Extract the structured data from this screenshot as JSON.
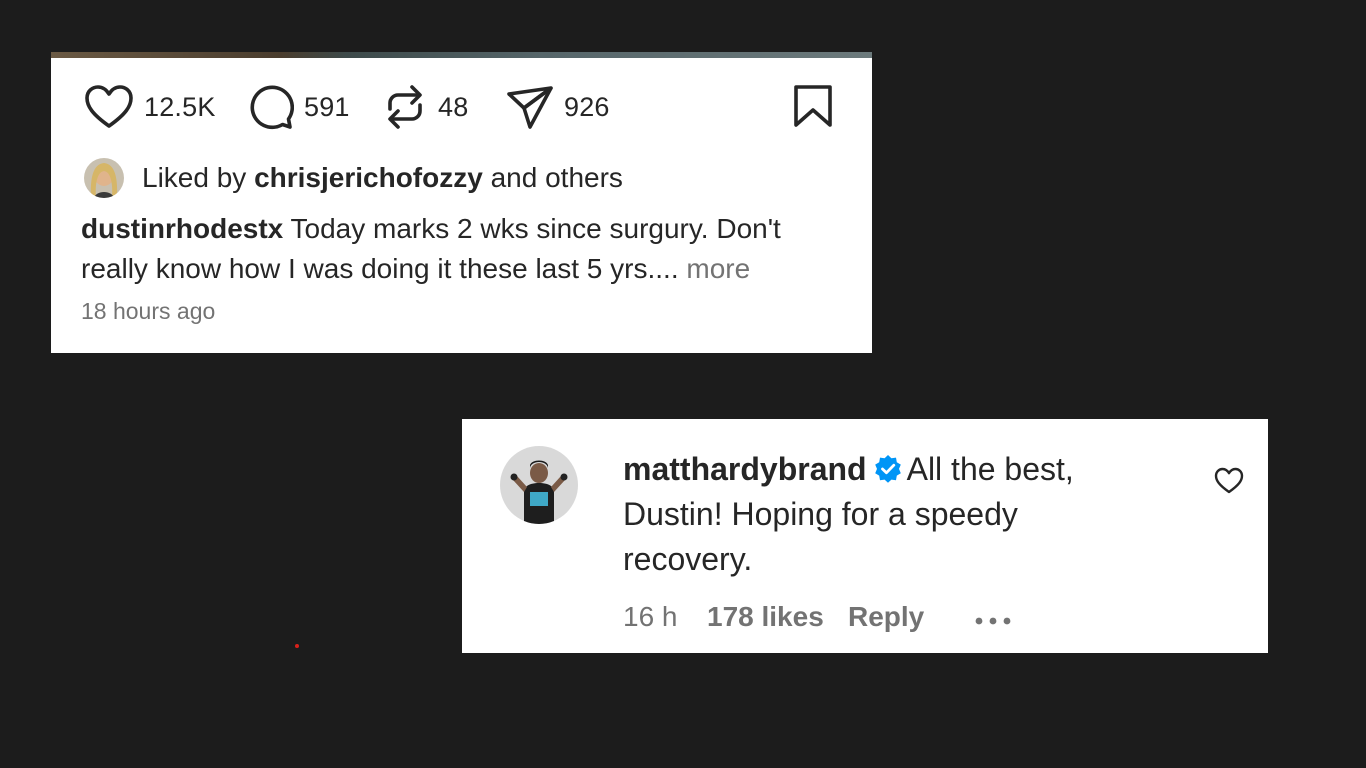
{
  "post": {
    "actions": {
      "likes": "12.5K",
      "comments": "591",
      "reposts": "48",
      "shares": "926"
    },
    "liked_by": {
      "prefix": "Liked by ",
      "user": "chrisjerichofozzy",
      "suffix": " and others"
    },
    "caption": {
      "user": "dustinrhodestx",
      "text": " Today marks 2 wks since surgury. Don't really know how I was doing it these last 5 yrs.... ",
      "more": "more"
    },
    "time": "18 hours ago"
  },
  "comment": {
    "user": "matthardybrand",
    "text": "All the best, Dustin! Hoping for a speedy recovery.",
    "time": "16 h",
    "likes": "178 likes",
    "reply": "Reply"
  },
  "colors": {
    "background": "#1c1c1c",
    "card": "#ffffff",
    "text": "#262626",
    "secondary_text": "#737373",
    "verified": "#0095f6"
  },
  "icons": [
    "heart-icon",
    "comment-icon",
    "repost-icon",
    "share-icon",
    "bookmark-icon",
    "verified-badge-icon",
    "more-dots-icon"
  ]
}
